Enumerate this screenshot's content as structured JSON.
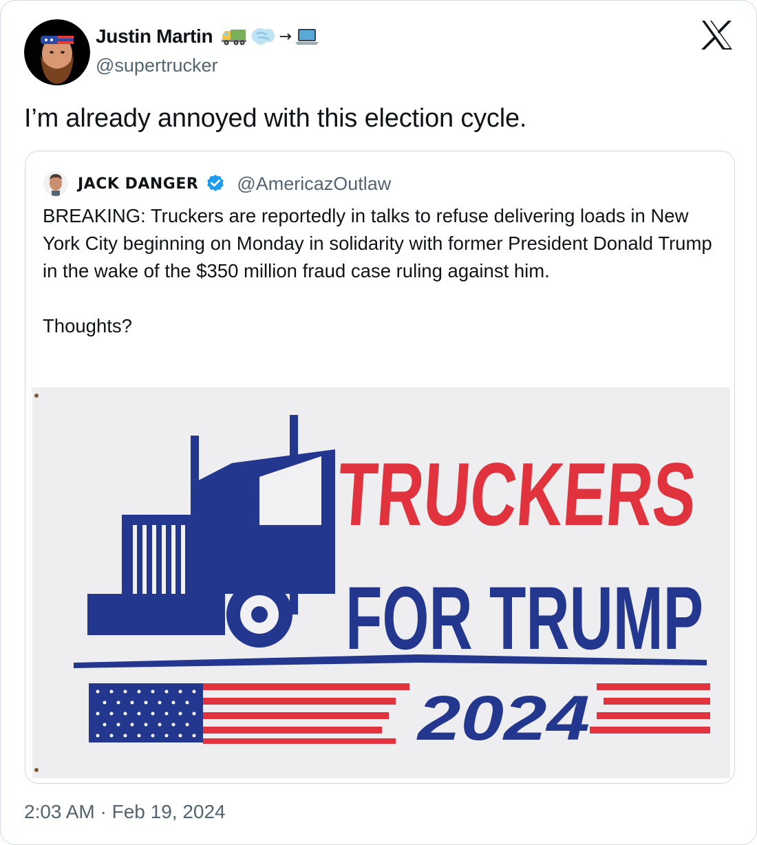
{
  "tweet": {
    "author_name": "Justin Martin",
    "name_arrow": "→",
    "handle": "@supertrucker",
    "text": "I’m already annoyed with this election cycle.",
    "timestamp": "2:03 AM · Feb 19, 2024"
  },
  "quoted": {
    "author_name": "JACK DANGER",
    "handle": "@AmericazOutlaw",
    "text": "BREAKING: Truckers are reportedly in talks to refuse delivering loads in New York City beginning on Monday in solidarity with former President Donald Trump in the wake of the $350 million fraud case ruling against him.\n\nThoughts?",
    "image": {
      "line1": "TRUCKERS",
      "line2": "FOR TRUMP",
      "line3": "2024"
    }
  },
  "icons": {
    "x_logo": "x-logo-icon",
    "verified": "verified-badge-icon",
    "name_emojis": [
      "truck-icon",
      "dash-icon",
      "laptop-icon"
    ]
  },
  "colors": {
    "text_primary": "#0f1419",
    "text_secondary": "#536471",
    "border": "#cfd9de",
    "verified_blue": "#1d9bf0",
    "flag_red": "#e0333e",
    "flag_blue": "#23378f"
  }
}
